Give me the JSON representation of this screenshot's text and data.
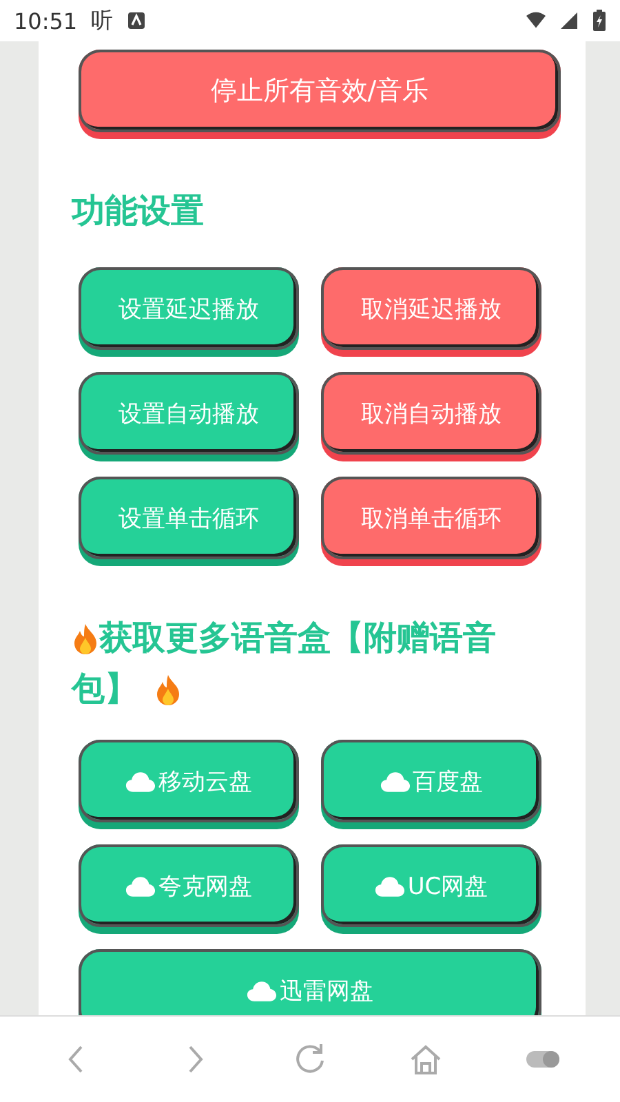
{
  "status_bar": {
    "time": "10:51",
    "notification": "听"
  },
  "stop_button": {
    "label": "停止所有音效/音乐",
    "kind": "cancel"
  },
  "settings": {
    "title": "功能设置",
    "buttons": [
      {
        "label": "设置延迟播放",
        "kind": "action"
      },
      {
        "label": "取消延迟播放",
        "kind": "cancel"
      },
      {
        "label": "设置自动播放",
        "kind": "action"
      },
      {
        "label": "取消自动播放",
        "kind": "cancel"
      },
      {
        "label": "设置单击循环",
        "kind": "action"
      },
      {
        "label": "取消单击循环",
        "kind": "cancel"
      }
    ]
  },
  "downloads": {
    "title_lines": [
      "获取更多语音盒【附赠语音",
      "包】"
    ],
    "buttons": [
      {
        "label": "移动云盘",
        "kind": "cloud"
      },
      {
        "label": "百度盘",
        "kind": "cloud"
      },
      {
        "label": "夸克网盘",
        "kind": "cloud"
      },
      {
        "label": "UC网盘",
        "kind": "cloud"
      },
      {
        "label": "迅雷网盘",
        "kind": "cloud",
        "wide": true
      }
    ]
  }
}
